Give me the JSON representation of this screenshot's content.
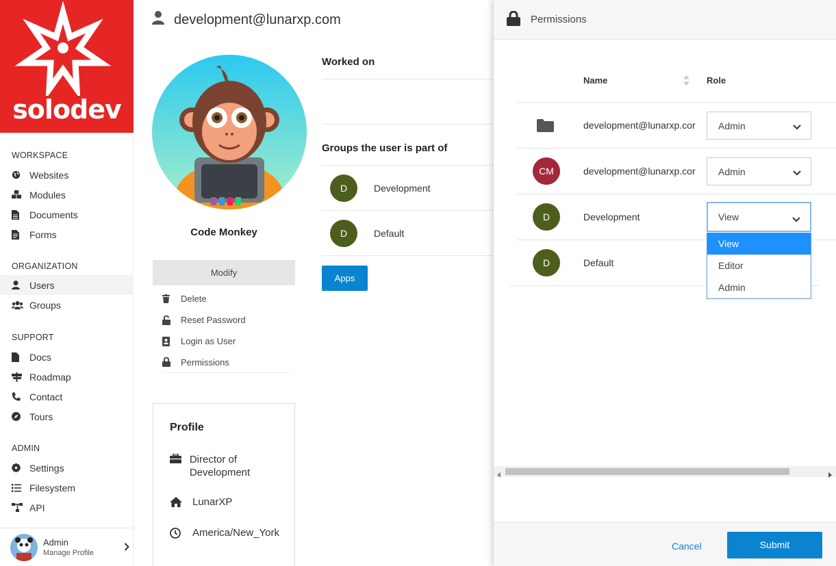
{
  "brand": {
    "name": "solodev",
    "color": "#e62625"
  },
  "sidebar": {
    "sections": [
      {
        "title": "WORKSPACE",
        "items": [
          {
            "label": "Websites",
            "icon": "globe-icon"
          },
          {
            "label": "Modules",
            "icon": "cubes-icon"
          },
          {
            "label": "Documents",
            "icon": "document-icon"
          },
          {
            "label": "Forms",
            "icon": "form-icon"
          }
        ]
      },
      {
        "title": "ORGANIZATION",
        "items": [
          {
            "label": "Users",
            "icon": "user-icon",
            "active": true
          },
          {
            "label": "Groups",
            "icon": "users-icon"
          }
        ]
      },
      {
        "title": "SUPPORT",
        "items": [
          {
            "label": "Docs",
            "icon": "file-icon"
          },
          {
            "label": "Roadmap",
            "icon": "signpost-icon"
          },
          {
            "label": "Contact",
            "icon": "phone-icon"
          },
          {
            "label": "Tours",
            "icon": "compass-icon"
          }
        ]
      },
      {
        "title": "ADMIN",
        "items": [
          {
            "label": "Settings",
            "icon": "gear-icon"
          },
          {
            "label": "Filesystem",
            "icon": "list-icon"
          },
          {
            "label": "API",
            "icon": "sitemap-icon"
          }
        ]
      }
    ],
    "footer": {
      "name": "Admin",
      "subtitle": "Manage Profile"
    }
  },
  "main": {
    "email": "development@lunarxp.com",
    "display_name": "Code Monkey",
    "modify_label": "Modify",
    "actions": [
      {
        "label": "Delete",
        "icon": "trash-icon"
      },
      {
        "label": "Reset Password",
        "icon": "unlock-icon"
      },
      {
        "label": "Login as User",
        "icon": "id-card-icon"
      },
      {
        "label": "Permissions",
        "icon": "lock-icon"
      }
    ],
    "profile": {
      "title": "Profile",
      "job_title": "Director of Development",
      "company": "LunarXP",
      "timezone": "America/New_York"
    },
    "worked_on_title": "Worked on",
    "groups_title": "Groups the user is part of",
    "groups": [
      {
        "initial": "D",
        "name": "Development"
      },
      {
        "initial": "D",
        "name": "Default"
      }
    ],
    "apps_label": "Apps"
  },
  "permissions": {
    "title": "Permissions",
    "columns": {
      "name": "Name",
      "role": "Role"
    },
    "rows": [
      {
        "type": "folder",
        "name": "development@lunarxp.cor",
        "role": "Admin"
      },
      {
        "type": "user",
        "initials": "CM",
        "color": "#a3283b",
        "name": "development@lunarxp.cor",
        "role": "Admin"
      },
      {
        "type": "group",
        "initials": "D",
        "color": "#4d5e1c",
        "name": "Development",
        "role": "View"
      },
      {
        "type": "group",
        "initials": "D",
        "color": "#4d5e1c",
        "name": "Default",
        "role": ""
      }
    ],
    "dropdown_options": [
      "View",
      "Editor",
      "Admin"
    ],
    "dropdown_selected": "View",
    "cancel_label": "Cancel",
    "submit_label": "Submit",
    "accent": "#0a84cf"
  }
}
